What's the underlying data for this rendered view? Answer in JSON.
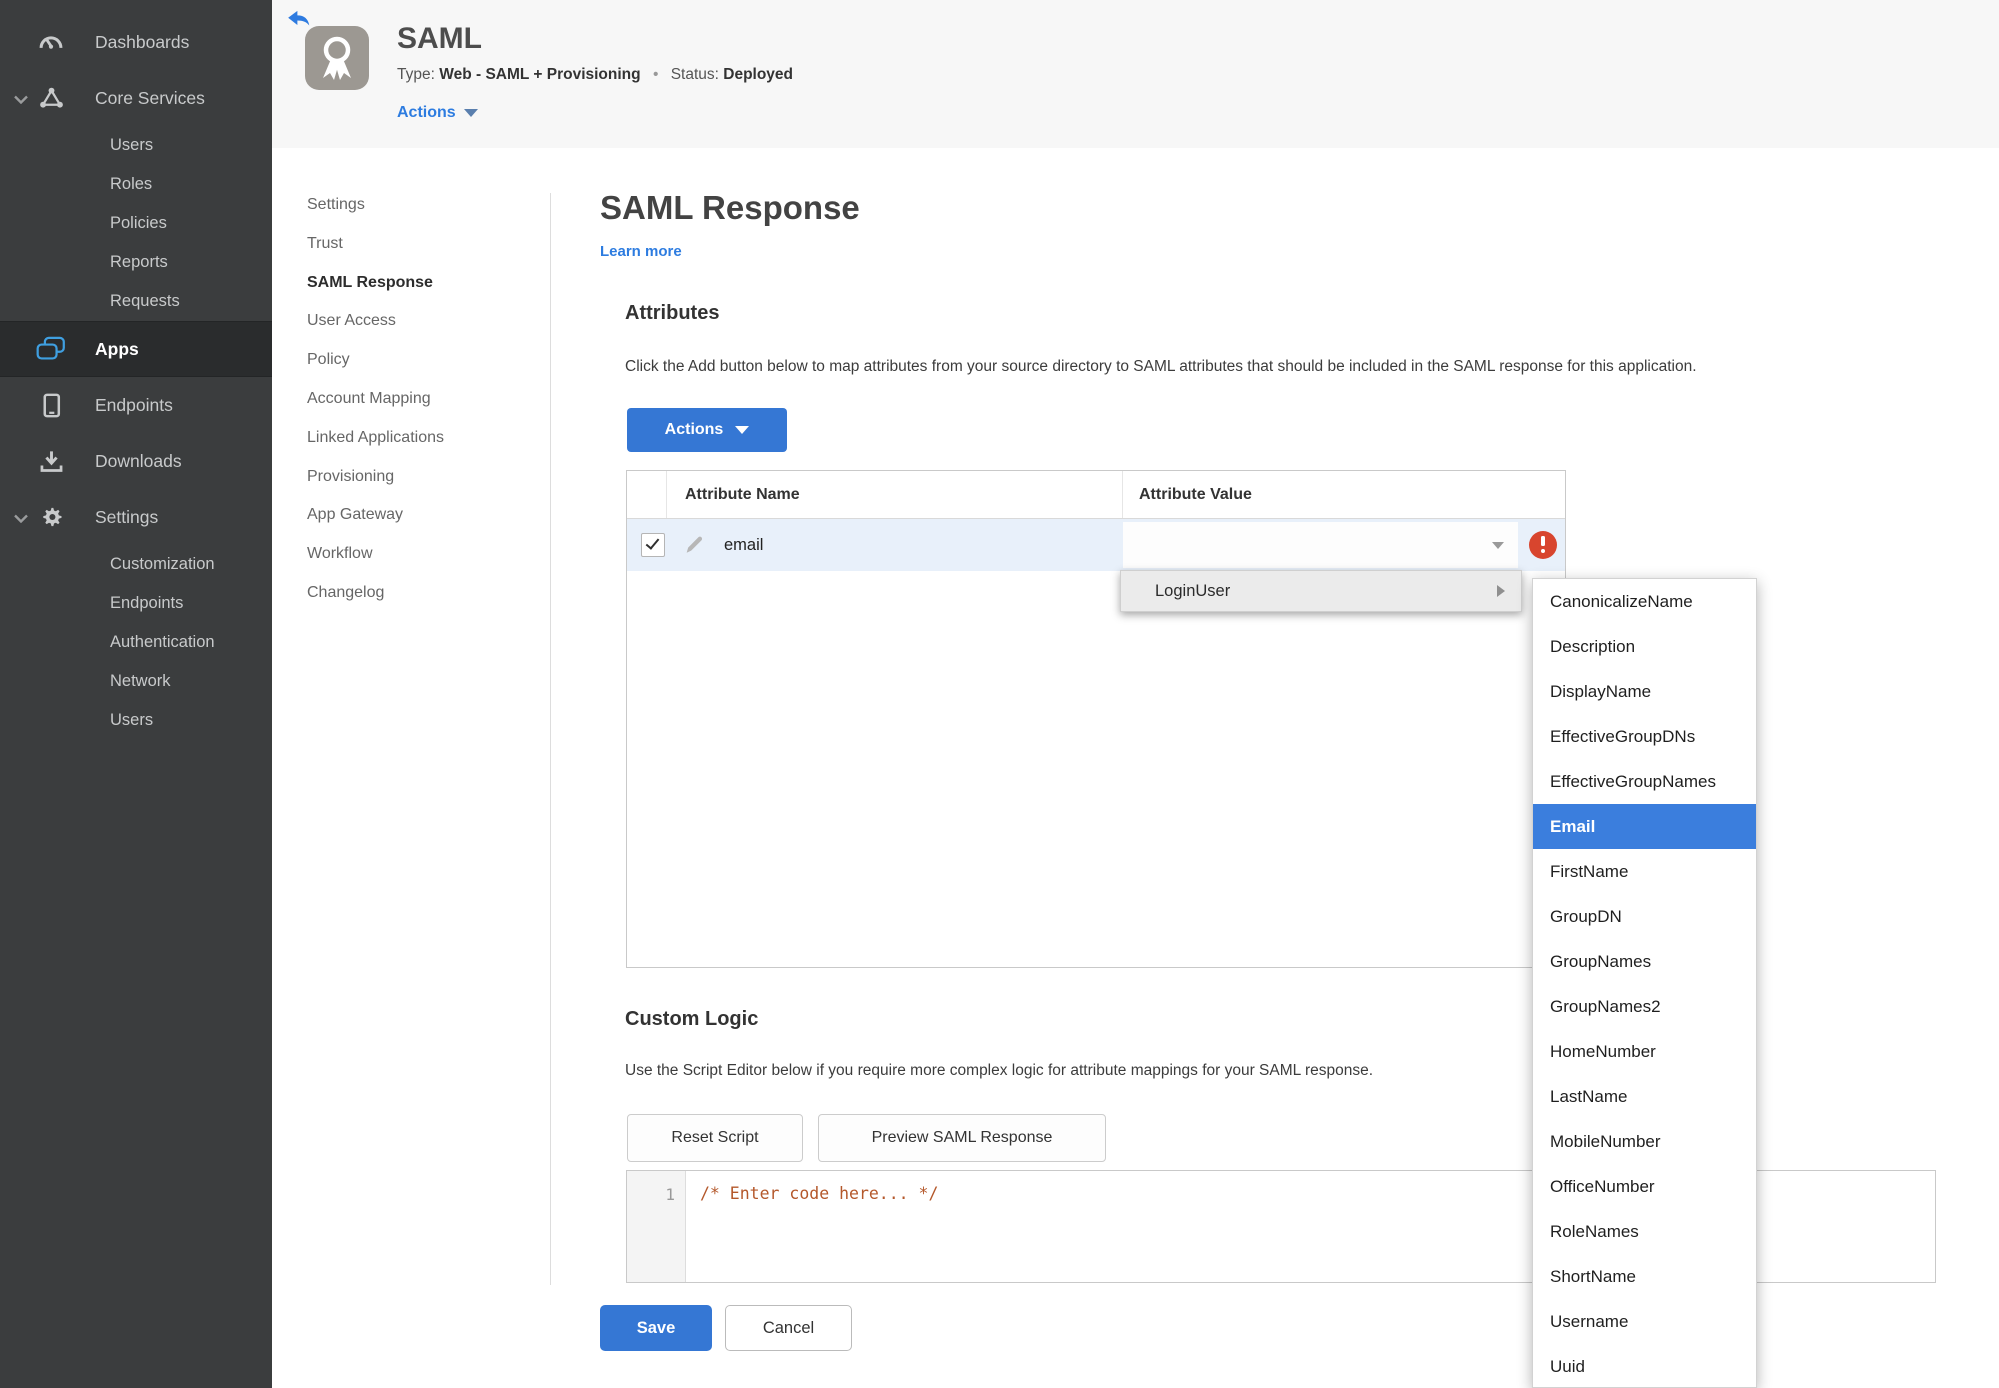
{
  "sidebar": {
    "items": [
      {
        "label": "Dashboards"
      },
      {
        "label": "Core Services"
      },
      {
        "label": "Users"
      },
      {
        "label": "Roles"
      },
      {
        "label": "Policies"
      },
      {
        "label": "Reports"
      },
      {
        "label": "Requests"
      },
      {
        "label": "Apps"
      },
      {
        "label": "Endpoints"
      },
      {
        "label": "Downloads"
      },
      {
        "label": "Settings"
      },
      {
        "label": "Customization"
      },
      {
        "label": "Endpoints"
      },
      {
        "label": "Authentication"
      },
      {
        "label": "Network"
      },
      {
        "label": "Users"
      }
    ]
  },
  "header": {
    "app_name": "SAML",
    "type_label": "Type:",
    "type_value": "Web - SAML + Provisioning",
    "dot": "•",
    "status_label": "Status:",
    "status_value": "Deployed",
    "actions_label": "Actions"
  },
  "subnav": {
    "items": [
      {
        "label": "Settings"
      },
      {
        "label": "Trust"
      },
      {
        "label": "SAML Response"
      },
      {
        "label": "User Access"
      },
      {
        "label": "Policy"
      },
      {
        "label": "Account Mapping"
      },
      {
        "label": "Linked Applications"
      },
      {
        "label": "Provisioning"
      },
      {
        "label": "App Gateway"
      },
      {
        "label": "Workflow"
      },
      {
        "label": "Changelog"
      }
    ],
    "active": "SAML Response"
  },
  "main": {
    "title": "SAML Response",
    "learn_more": "Learn more",
    "attributes": {
      "heading": "Attributes",
      "description": "Click the Add button below to map attributes from your source directory to SAML attributes that should be included in the SAML response for this application.",
      "actions_button": "Actions"
    },
    "table": {
      "headers": {
        "name": "Attribute Name",
        "value": "Attribute Value"
      },
      "row": {
        "name": "email",
        "value": ""
      }
    },
    "dropdown": {
      "label": "LoginUser"
    },
    "submenu": {
      "items": [
        "CanonicalizeName",
        "Description",
        "DisplayName",
        "EffectiveGroupDNs",
        "EffectiveGroupNames",
        "Email",
        "FirstName",
        "GroupDN",
        "GroupNames",
        "GroupNames2",
        "HomeNumber",
        "LastName",
        "MobileNumber",
        "OfficeNumber",
        "RoleNames",
        "ShortName",
        "Username",
        "Uuid"
      ],
      "selected": "Email"
    },
    "custom_logic": {
      "heading": "Custom Logic",
      "description": "Use the Script Editor below if you require more complex logic for attribute mappings for your SAML response.",
      "reset_button": "Reset Script",
      "preview_button": "Preview SAML Response",
      "editor_line_number": "1",
      "editor_code": "/* Enter code here... */"
    },
    "footer": {
      "save": "Save",
      "cancel": "Cancel"
    }
  },
  "colors": {
    "accent_blue": "#3577d4",
    "link_blue": "#2d7ce0",
    "selected_blue": "#3b7edd",
    "status_green": "#3f8e3d",
    "error_red": "#d8452e",
    "sidebar_bg": "#3b3d3e",
    "sidebar_active_bg": "#2a2c2d",
    "row_highlight": "#e8f0fa",
    "code_orange": "#b4582b"
  }
}
